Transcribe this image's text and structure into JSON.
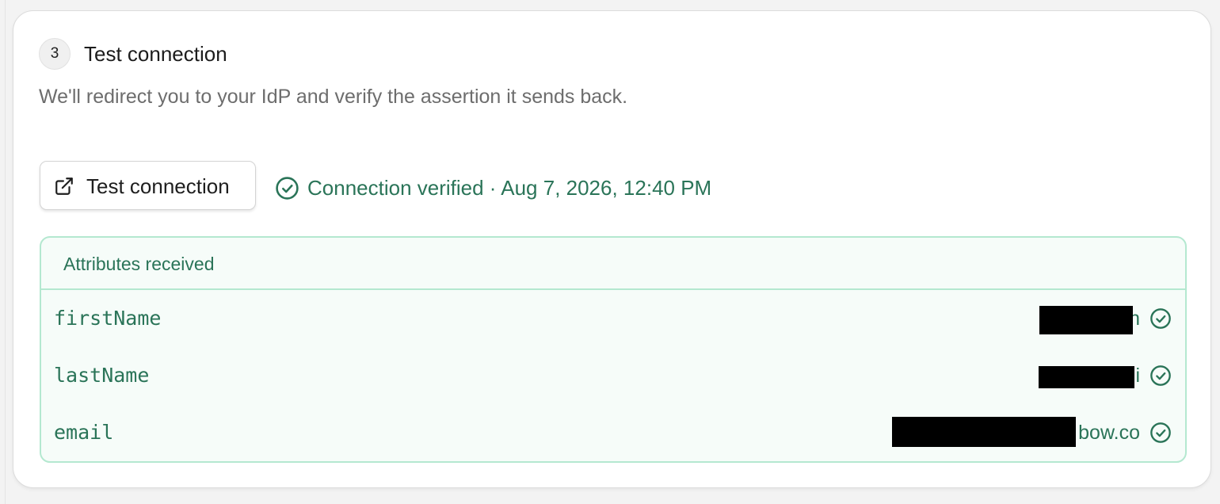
{
  "step": {
    "number": "3",
    "title": "Test connection",
    "description": "We'll redirect you to your IdP and verify the assertion it sends back."
  },
  "actions": {
    "test_button_label": "Test connection",
    "test_button_icon": "external-link-icon"
  },
  "status": {
    "icon": "check-circle-icon",
    "text": "Connection verified · Aug 7, 2026, 12:40 PM",
    "color": "#2a7458"
  },
  "attributes": {
    "title": "Attributes received",
    "rows": [
      {
        "key": "firstName",
        "value": "n",
        "status_icon": "check-circle-icon"
      },
      {
        "key": "lastName",
        "value": "i",
        "status_icon": "check-circle-icon"
      },
      {
        "key": "email",
        "value": "bow.co",
        "status_icon": "check-circle-icon"
      }
    ]
  },
  "colors": {
    "success": "#2a7458",
    "panel_background": "#f6fcf9",
    "panel_border": "#b4e8d0"
  }
}
